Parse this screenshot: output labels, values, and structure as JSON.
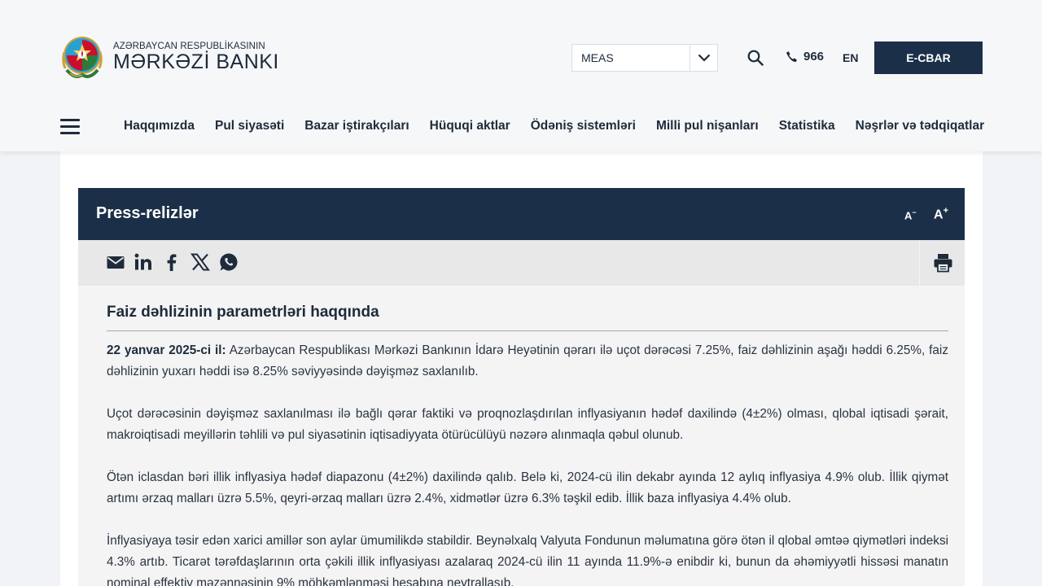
{
  "header": {
    "logo_small": "AZƏRBAYCAN RESPUBLİKASININ",
    "logo_big": "MƏRKƏZİ BANKI",
    "select_value": "MEAS",
    "phone": "966",
    "lang": "EN",
    "ecbar": "E-CBAR"
  },
  "nav": {
    "items": [
      "Haqqımızda",
      "Pul siyasəti",
      "Bazar iştirakçıları",
      "Hüquqi aktlar",
      "Ödəniş sistemləri",
      "Milli pul nişanları",
      "Statistika",
      "Nəşrlər və tədqiqatlar"
    ]
  },
  "section": {
    "title": "Press-relizlər",
    "font_minus": "A",
    "font_plus": "A"
  },
  "article": {
    "title": "Faiz dəhlizinin parametrləri haqqında",
    "date": "22 yanvar 2025-ci il:",
    "p1": " Azərbaycan Respublikası Mərkəzi Bankının İdarə Heyətinin qərarı ilə uçot dərəcəsi 7.25%, faiz dəhlizinin aşağı həddi 6.25%, faiz dəhlizinin yuxarı həddi isə 8.25% səviyyəsində dəyişməz saxlanılıb.",
    "p2": "Uçot dərəcəsinin dəyişməz saxlanılması ilə bağlı qərar faktiki və proqnozlaşdırılan inflyasiyanın hədəf daxilində (4±2%) olması, qlobal iqtisadi şərait, makroiqtisadi meyillərin təhlili və pul siyasətinin iqtisadiyyata ötürücülüyü nəzərə alınmaqla qəbul olunub.",
    "p3": "Ötən iclasdan bəri illik inflyasiya hədəf diapazonu (4±2%) daxilində qalıb. Belə ki, 2024-cü ilin dekabr ayında 12 aylıq inflyasiya 4.9% olub. İllik qiymət artımı ərzaq malları üzrə 5.5%, qeyri-ərzaq malları üzrə 2.4%, xidmətlər üzrə 6.3% təşkil edib. İllik baza inflyasiya 4.4% olub.",
    "p4": "İnflyasiyaya təsir edən xarici amillər son aylar ümumilikdə stabildir. Beynəlxalq Valyuta Fondunun məlumatına görə ötən il qlobal əmtəə qiymətləri indeksi 4.3% artıb. Ticarət tərəfdaşlarının orta çəkili illik inflyasiyası azalaraq 2024-cü ilin 11 ayında 11.9%-ə enibdir ki, bunun da əhəmiyyətli hissəsi manatın nominal effektiv məzənnəsinin 9% möhkəmlənməsi hesabına neytrallaşıb."
  },
  "colors": {
    "navy": "#1b3048",
    "text": "#1d2b3a",
    "emblem_red": "#c8102e",
    "emblem_green": "#2f7a3a",
    "emblem_gold": "#c9a23a"
  }
}
